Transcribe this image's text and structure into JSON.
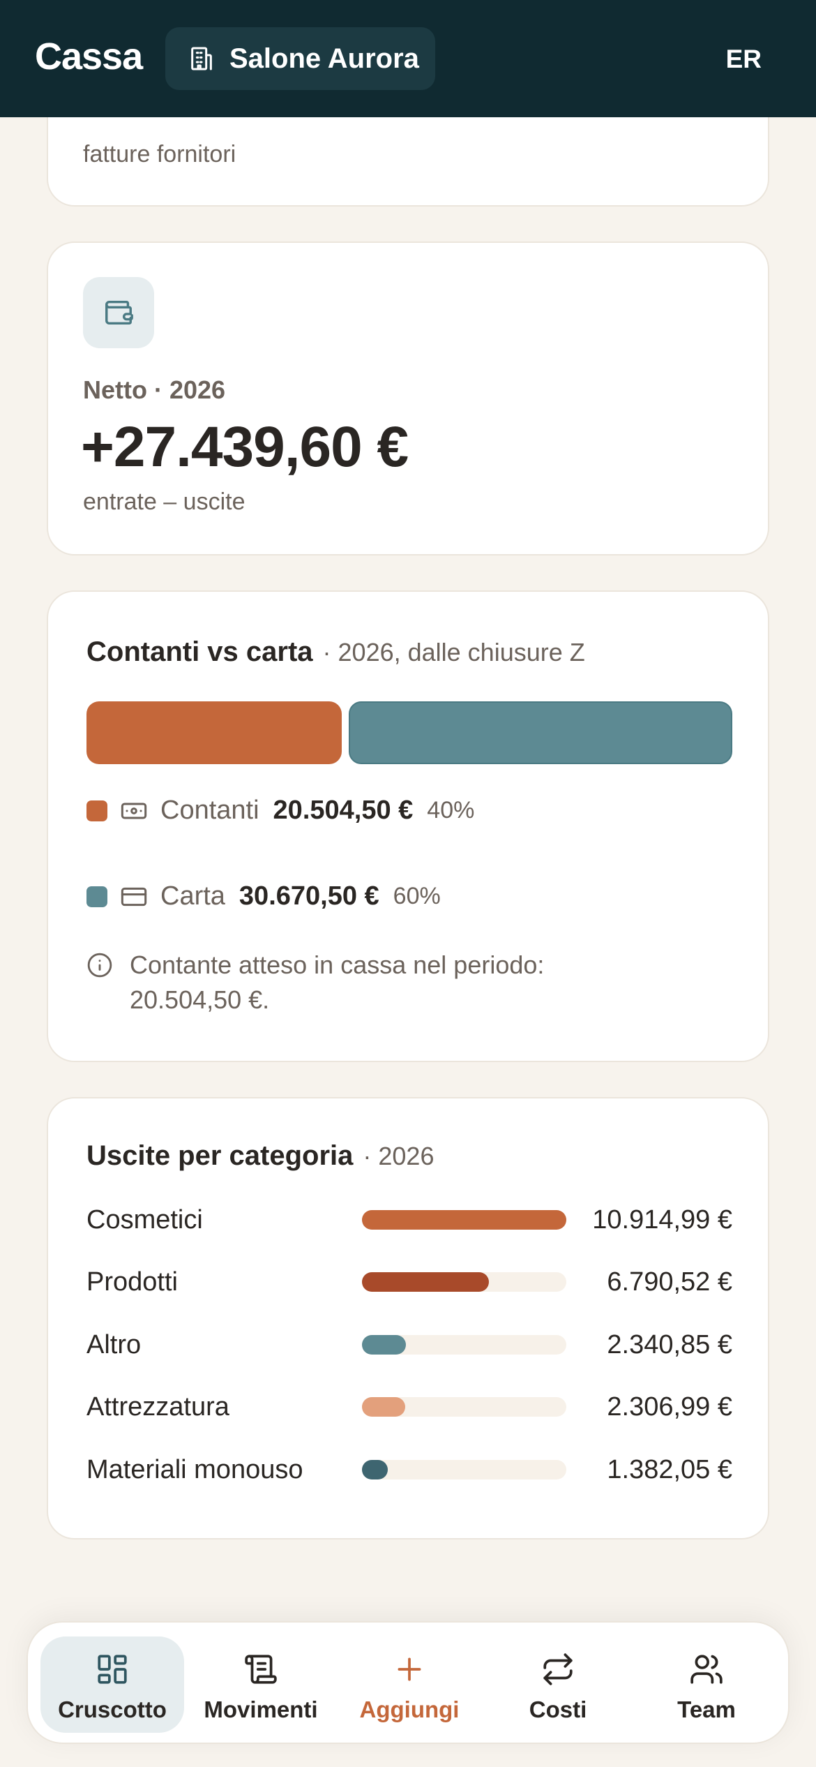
{
  "header": {
    "brand": "Cassa",
    "salon_name": "Salone Aurora",
    "lang": "ER"
  },
  "card_prev": {
    "subtitle": "fatture fornitori"
  },
  "net_card": {
    "label": "Netto · 2026",
    "value": "+27.439,60 €",
    "subtitle": "entrate – uscite",
    "icon": "wallet-icon"
  },
  "cash_vs_card": {
    "title": "Contanti vs carta",
    "subtitle": "· 2026, dalle chiusure Z",
    "cash": {
      "label": "Contanti",
      "amount": "20.504,50 €",
      "percent": "40%",
      "share": 0.4,
      "color": "#c4673a",
      "icon": "banknote-icon"
    },
    "card": {
      "label": "Carta",
      "amount": "30.670,50 €",
      "percent": "60%",
      "share": 0.6,
      "color": "#5d8a93",
      "icon": "credit-card-icon"
    },
    "note": "Contante atteso in cassa nel periodo: 20.504,50 €."
  },
  "expenses": {
    "title": "Uscite per categoria",
    "subtitle": "· 2026",
    "rows": [
      {
        "name": "Cosmetici",
        "value": "10.914,99 €",
        "share": 1.0,
        "color": "#c4673a"
      },
      {
        "name": "Prodotti",
        "value": "6.790,52 €",
        "share": 0.622,
        "color": "#a84a2a"
      },
      {
        "name": "Altro",
        "value": "2.340,85 €",
        "share": 0.214,
        "color": "#5d8a93"
      },
      {
        "name": "Attrezzatura",
        "value": "2.306,99 €",
        "share": 0.211,
        "color": "#e3a07c"
      },
      {
        "name": "Materiali monouso",
        "value": "1.382,05 €",
        "share": 0.127,
        "color": "#3e6570"
      }
    ]
  },
  "nav": {
    "items": [
      {
        "label": "Cruscotto",
        "icon": "dashboard-icon",
        "active": true
      },
      {
        "label": "Movimenti",
        "icon": "receipt-icon",
        "active": false
      },
      {
        "label": "Aggiungi",
        "icon": "plus-icon",
        "active": false
      },
      {
        "label": "Costi",
        "icon": "repeat-icon",
        "active": false
      },
      {
        "label": "Team",
        "icon": "users-icon",
        "active": false
      }
    ]
  }
}
